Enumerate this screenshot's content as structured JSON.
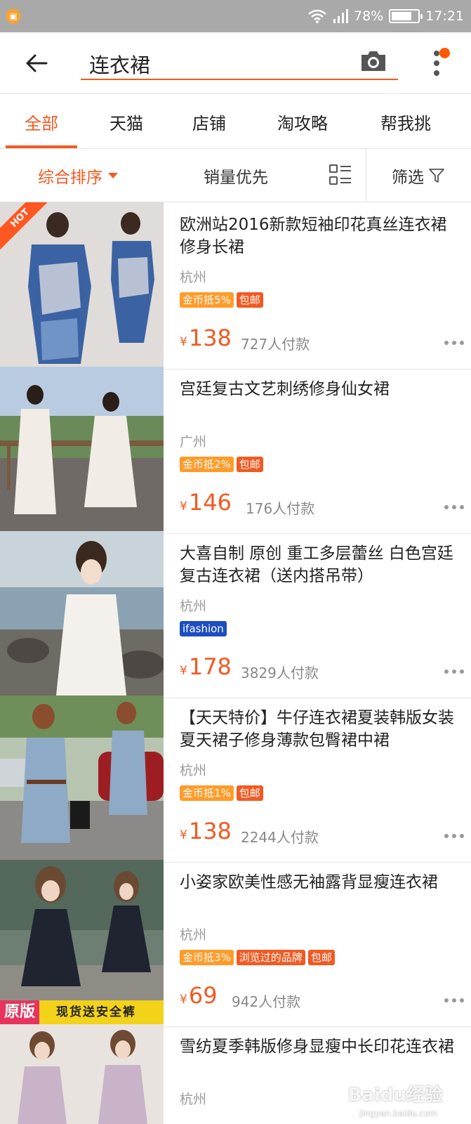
{
  "status_bar": {
    "battery": "78%",
    "battery_level": 0.78,
    "time": "17:21",
    "icons": [
      "app-notification-icon",
      "wifi-icon",
      "signal-icon",
      "battery-icon"
    ]
  },
  "search": {
    "query": "连衣裙",
    "icons": [
      "back-arrow-icon",
      "camera-icon",
      "more-vertical-icon"
    ]
  },
  "tabs": [
    "全部",
    "天猫",
    "店铺",
    "淘攻略",
    "帮我挑"
  ],
  "active_tab": "全部",
  "sort": {
    "comprehensive": "综合排序",
    "sales": "销量优先",
    "filter": "筛选",
    "icons": [
      "caret-down-icon",
      "list-view-icon",
      "filter-funnel-icon"
    ]
  },
  "colors": {
    "accent": "#f15a22",
    "coin_tag": "#ff9b29",
    "ifashion_tag": "#1e4dc1",
    "status_bar": "#a9a9a9"
  },
  "products": [
    {
      "title": "欧洲站2016新款短袖印花真丝连衣裙修身长裙",
      "city": "杭州",
      "tags": [
        "金币抵5%",
        "包邮"
      ],
      "price": "138",
      "currency": "¥",
      "sales": "727人付款",
      "badge": "HOT"
    },
    {
      "title": "宫廷复古文艺刺绣修身仙女裙",
      "city": "广州",
      "tags": [
        "金币抵2%",
        "包邮"
      ],
      "price": "146",
      "currency": "¥",
      "sales": "176人付款"
    },
    {
      "title": "大喜自制 原创 重工多层蕾丝 白色宫廷复古连衣裙（送内搭吊带）",
      "city": "杭州",
      "tags": [
        "ifashion"
      ],
      "price": "178",
      "currency": "¥",
      "sales": "3829人付款"
    },
    {
      "title": "【天天特价】牛仔连衣裙夏装韩版女装夏天裙子修身薄款包臀裙中裙",
      "city": "杭州",
      "tags": [
        "金币抵1%",
        "包邮"
      ],
      "price": "138",
      "currency": "¥",
      "sales": "2244人付款"
    },
    {
      "title": "小姿家欧美性感无袖露背显瘦连衣裙",
      "city": "杭州",
      "tags": [
        "金币抵3%",
        "浏览过的品牌",
        "包邮"
      ],
      "price": "69",
      "currency": "¥",
      "sales": "942人付款",
      "banner_tag": "原版",
      "banner_text": "现货送安全裤"
    },
    {
      "title": "雪纺夏季韩版修身显瘦中长印花连衣裙",
      "city": "杭州"
    }
  ],
  "watermark": {
    "main": "Baidu经验",
    "sub": "jingyan.baidu.com"
  }
}
